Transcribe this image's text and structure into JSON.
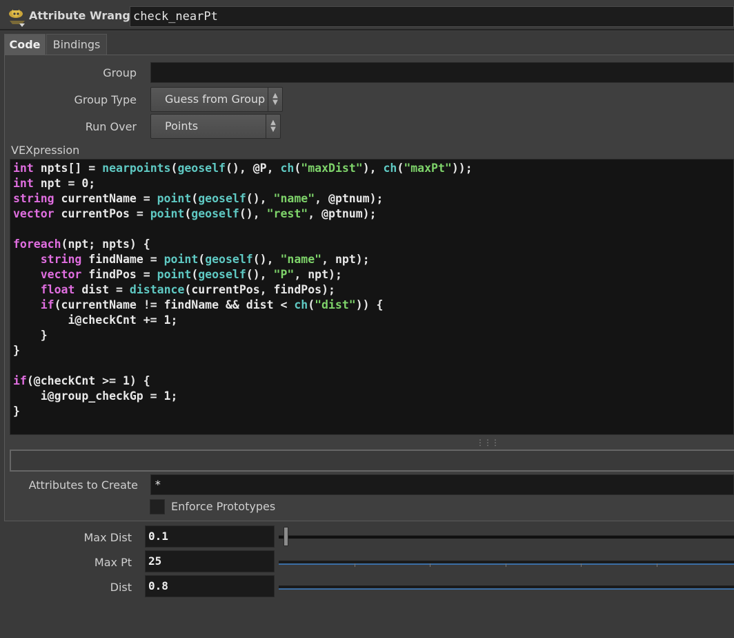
{
  "header": {
    "node_type": "Attribute Wrangle",
    "node_name": "check_nearPt"
  },
  "tabs": [
    {
      "label": "Code",
      "active": true
    },
    {
      "label": "Bindings",
      "active": false
    }
  ],
  "params": {
    "group_label": "Group",
    "group_value": "",
    "group_type_label": "Group Type",
    "group_type_value": "Guess from Group",
    "run_over_label": "Run Over",
    "run_over_value": "Points",
    "vex_label": "VEXpression",
    "attributes_label": "Attributes to Create",
    "attributes_value": "*",
    "enforce_label": "Enforce Prototypes",
    "enforce_checked": false
  },
  "code_lines": [
    "int npts[] = nearpoints(geoself(), @P, ch(\"maxDist\"), ch(\"maxPt\"));",
    "int npt = 0;",
    "string currentName = point(geoself(), \"name\", @ptnum);",
    "vector currentPos = point(geoself(), \"rest\", @ptnum);",
    "",
    "foreach(npt; npts) {",
    "    string findName = point(geoself(), \"name\", npt);",
    "    vector findPos = point(geoself(), \"P\", npt);",
    "    float dist = distance(currentPos, findPos);",
    "    if(currentName != findName && dist < ch(\"dist\")) {",
    "        i@checkCnt += 1;",
    "    }",
    "}",
    "",
    "if(@checkCnt >= 1) {",
    "    i@group_checkGp = 1;",
    "}"
  ],
  "spare_params": [
    {
      "label": "Max Dist",
      "value": "0.1"
    },
    {
      "label": "Max Pt",
      "value": "25"
    },
    {
      "label": "Dist",
      "value": "0.8"
    }
  ],
  "colors": {
    "keyword": "#e06ee0",
    "function": "#5fc9c3",
    "string": "#7ed36a",
    "slider_blue": "#3b6ea5"
  },
  "icons": [
    "wrangle-node-icon",
    "menu-arrows-icon",
    "resize-grip-icon"
  ]
}
